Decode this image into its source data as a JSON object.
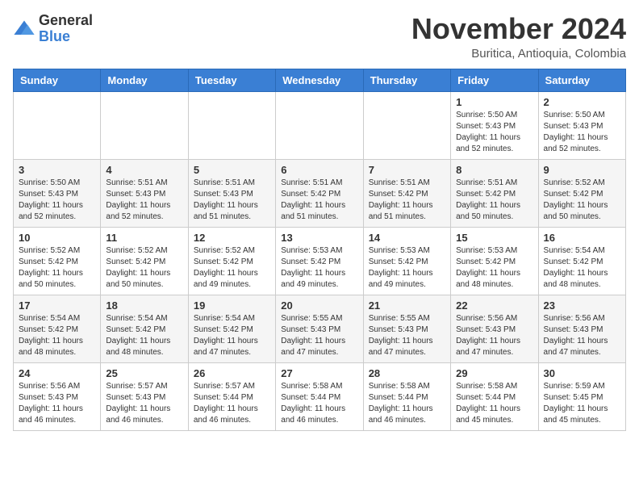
{
  "logo": {
    "line1": "General",
    "line2": "Blue"
  },
  "header": {
    "month": "November 2024",
    "location": "Buritica, Antioquia, Colombia"
  },
  "days_of_week": [
    "Sunday",
    "Monday",
    "Tuesday",
    "Wednesday",
    "Thursday",
    "Friday",
    "Saturday"
  ],
  "weeks": [
    {
      "days": [
        {
          "num": "",
          "info": ""
        },
        {
          "num": "",
          "info": ""
        },
        {
          "num": "",
          "info": ""
        },
        {
          "num": "",
          "info": ""
        },
        {
          "num": "",
          "info": ""
        },
        {
          "num": "1",
          "info": "Sunrise: 5:50 AM\nSunset: 5:43 PM\nDaylight: 11 hours\nand 52 minutes."
        },
        {
          "num": "2",
          "info": "Sunrise: 5:50 AM\nSunset: 5:43 PM\nDaylight: 11 hours\nand 52 minutes."
        }
      ]
    },
    {
      "days": [
        {
          "num": "3",
          "info": "Sunrise: 5:50 AM\nSunset: 5:43 PM\nDaylight: 11 hours\nand 52 minutes."
        },
        {
          "num": "4",
          "info": "Sunrise: 5:51 AM\nSunset: 5:43 PM\nDaylight: 11 hours\nand 52 minutes."
        },
        {
          "num": "5",
          "info": "Sunrise: 5:51 AM\nSunset: 5:43 PM\nDaylight: 11 hours\nand 51 minutes."
        },
        {
          "num": "6",
          "info": "Sunrise: 5:51 AM\nSunset: 5:42 PM\nDaylight: 11 hours\nand 51 minutes."
        },
        {
          "num": "7",
          "info": "Sunrise: 5:51 AM\nSunset: 5:42 PM\nDaylight: 11 hours\nand 51 minutes."
        },
        {
          "num": "8",
          "info": "Sunrise: 5:51 AM\nSunset: 5:42 PM\nDaylight: 11 hours\nand 50 minutes."
        },
        {
          "num": "9",
          "info": "Sunrise: 5:52 AM\nSunset: 5:42 PM\nDaylight: 11 hours\nand 50 minutes."
        }
      ]
    },
    {
      "days": [
        {
          "num": "10",
          "info": "Sunrise: 5:52 AM\nSunset: 5:42 PM\nDaylight: 11 hours\nand 50 minutes."
        },
        {
          "num": "11",
          "info": "Sunrise: 5:52 AM\nSunset: 5:42 PM\nDaylight: 11 hours\nand 50 minutes."
        },
        {
          "num": "12",
          "info": "Sunrise: 5:52 AM\nSunset: 5:42 PM\nDaylight: 11 hours\nand 49 minutes."
        },
        {
          "num": "13",
          "info": "Sunrise: 5:53 AM\nSunset: 5:42 PM\nDaylight: 11 hours\nand 49 minutes."
        },
        {
          "num": "14",
          "info": "Sunrise: 5:53 AM\nSunset: 5:42 PM\nDaylight: 11 hours\nand 49 minutes."
        },
        {
          "num": "15",
          "info": "Sunrise: 5:53 AM\nSunset: 5:42 PM\nDaylight: 11 hours\nand 48 minutes."
        },
        {
          "num": "16",
          "info": "Sunrise: 5:54 AM\nSunset: 5:42 PM\nDaylight: 11 hours\nand 48 minutes."
        }
      ]
    },
    {
      "days": [
        {
          "num": "17",
          "info": "Sunrise: 5:54 AM\nSunset: 5:42 PM\nDaylight: 11 hours\nand 48 minutes."
        },
        {
          "num": "18",
          "info": "Sunrise: 5:54 AM\nSunset: 5:42 PM\nDaylight: 11 hours\nand 48 minutes."
        },
        {
          "num": "19",
          "info": "Sunrise: 5:54 AM\nSunset: 5:42 PM\nDaylight: 11 hours\nand 47 minutes."
        },
        {
          "num": "20",
          "info": "Sunrise: 5:55 AM\nSunset: 5:43 PM\nDaylight: 11 hours\nand 47 minutes."
        },
        {
          "num": "21",
          "info": "Sunrise: 5:55 AM\nSunset: 5:43 PM\nDaylight: 11 hours\nand 47 minutes."
        },
        {
          "num": "22",
          "info": "Sunrise: 5:56 AM\nSunset: 5:43 PM\nDaylight: 11 hours\nand 47 minutes."
        },
        {
          "num": "23",
          "info": "Sunrise: 5:56 AM\nSunset: 5:43 PM\nDaylight: 11 hours\nand 47 minutes."
        }
      ]
    },
    {
      "days": [
        {
          "num": "24",
          "info": "Sunrise: 5:56 AM\nSunset: 5:43 PM\nDaylight: 11 hours\nand 46 minutes."
        },
        {
          "num": "25",
          "info": "Sunrise: 5:57 AM\nSunset: 5:43 PM\nDaylight: 11 hours\nand 46 minutes."
        },
        {
          "num": "26",
          "info": "Sunrise: 5:57 AM\nSunset: 5:44 PM\nDaylight: 11 hours\nand 46 minutes."
        },
        {
          "num": "27",
          "info": "Sunrise: 5:58 AM\nSunset: 5:44 PM\nDaylight: 11 hours\nand 46 minutes."
        },
        {
          "num": "28",
          "info": "Sunrise: 5:58 AM\nSunset: 5:44 PM\nDaylight: 11 hours\nand 46 minutes."
        },
        {
          "num": "29",
          "info": "Sunrise: 5:58 AM\nSunset: 5:44 PM\nDaylight: 11 hours\nand 45 minutes."
        },
        {
          "num": "30",
          "info": "Sunrise: 5:59 AM\nSunset: 5:45 PM\nDaylight: 11 hours\nand 45 minutes."
        }
      ]
    }
  ]
}
